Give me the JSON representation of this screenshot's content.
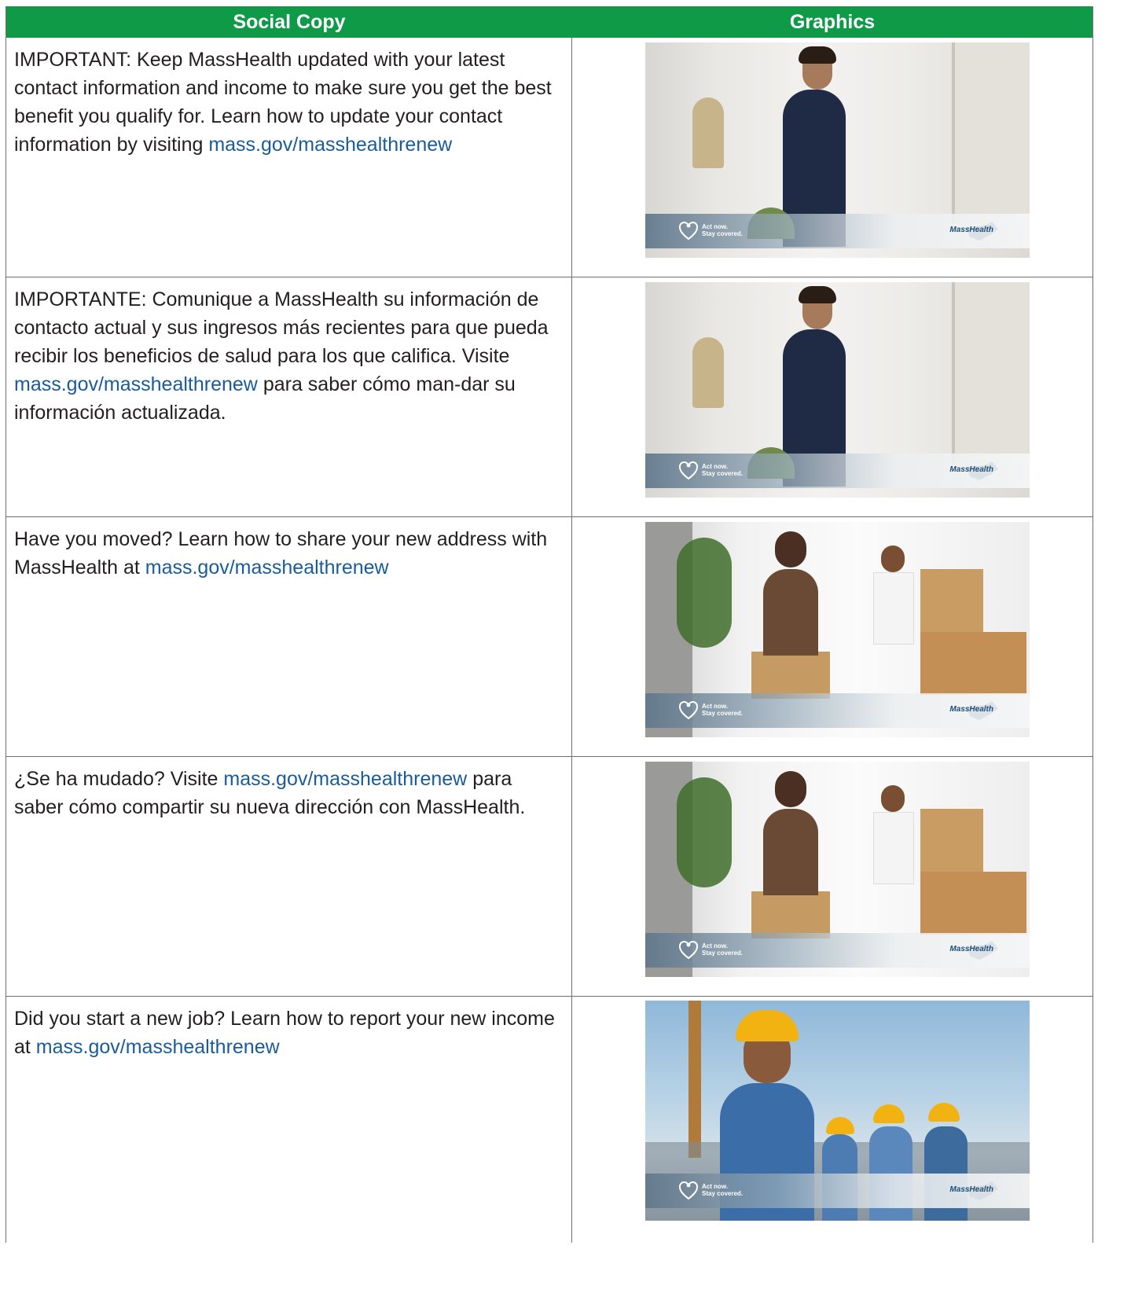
{
  "header": {
    "col1": "Social Copy",
    "col2": "Graphics"
  },
  "rows": [
    {
      "text_before": "IMPORTANT: Keep MassHealth updated with your latest contact information and income to make sure you get the best benefit you qualify for. Learn how to update your contact information by visiting ",
      "link": "mass.gov/masshealthrenew",
      "text_after": "",
      "graphic": {
        "scene": "woman-phone",
        "tag_line1": "Act now.",
        "tag_line2": "Stay covered.",
        "brand": "MassHealth"
      }
    },
    {
      "text_before": "IMPORTANTE: Comunique a MassHealth su información de contacto actual y sus ingresos más recientes para que pueda recibir los beneficios de salud para los que califica. Visite ",
      "link": "mass.gov/masshealthrenew",
      "text_after": " para saber cómo man-dar su información actualizada.",
      "graphic": {
        "scene": "woman-phone",
        "tag_line1": "Act now.",
        "tag_line2": "Stay covered.",
        "brand": "MassHealth"
      }
    },
    {
      "text_before": "Have you moved? Learn how to share your new address with MassHealth at ",
      "link": "mass.gov/masshealthrenew",
      "text_after": "",
      "graphic": {
        "scene": "family-moving",
        "tag_line1": "Act now.",
        "tag_line2": "Stay covered.",
        "brand": "MassHealth"
      }
    },
    {
      "text_before": "¿Se ha mudado? Visite ",
      "link": "mass.gov/masshealthrenew",
      "text_after": " para saber cómo compartir su nueva dirección con MassHealth.",
      "graphic": {
        "scene": "family-moving",
        "tag_line1": "Act now.",
        "tag_line2": "Stay covered.",
        "brand": "MassHealth"
      }
    },
    {
      "text_before": "Did you start a new job? Learn how to report your new income at ",
      "link": "mass.gov/masshealthrenew",
      "text_after": "",
      "graphic": {
        "scene": "construction-workers",
        "tag_line1": "Act now.",
        "tag_line2": "Stay covered.",
        "brand": "MassHealth"
      }
    }
  ],
  "colors": {
    "header_green": "#0e9a47",
    "link_blue": "#1a5c98",
    "border_gray": "#6d6e70"
  }
}
